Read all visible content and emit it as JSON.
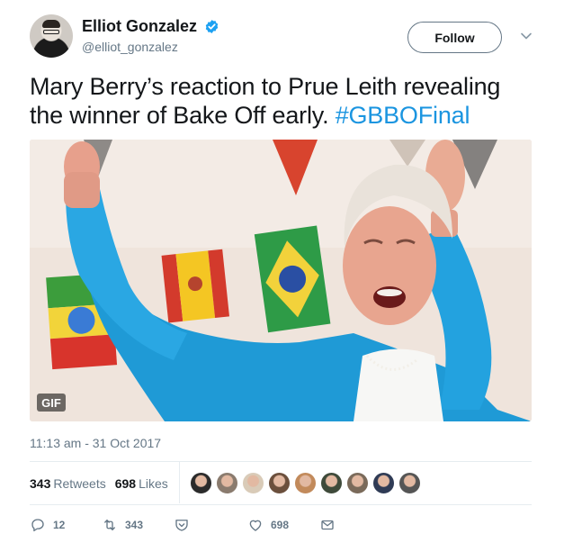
{
  "user": {
    "display_name": "Elliot Gonzalez",
    "handle": "@elliot_gonzalez",
    "verified": true
  },
  "follow_label": "Follow",
  "tweet": {
    "text": "Mary Berry’s reaction to Prue Leith revealing the winner of Bake Off early.",
    "hashtag": "#GBBOFinal"
  },
  "media": {
    "badge": "GIF"
  },
  "timestamp": "11:13 am - 31 Oct 2017",
  "stats": {
    "retweets_count": "343",
    "retweets_label": "Retweets",
    "likes_count": "698",
    "likes_label": "Likes"
  },
  "likers": [
    {
      "color": "#2b2b2b"
    },
    {
      "color": "#8a7b6e"
    },
    {
      "color": "#d9cbb8"
    },
    {
      "color": "#6b4f3c"
    },
    {
      "color": "#c28a5b"
    },
    {
      "color": "#3e4a3a"
    },
    {
      "color": "#7a6a5a"
    },
    {
      "color": "#2f3b55"
    },
    {
      "color": "#555555"
    }
  ],
  "actions": {
    "reply_count": "12",
    "retweet_count": "343",
    "like_count": "698"
  },
  "colors": {
    "link": "#1b95e0",
    "secondary": "#657786",
    "verified": "#1da1f2"
  }
}
